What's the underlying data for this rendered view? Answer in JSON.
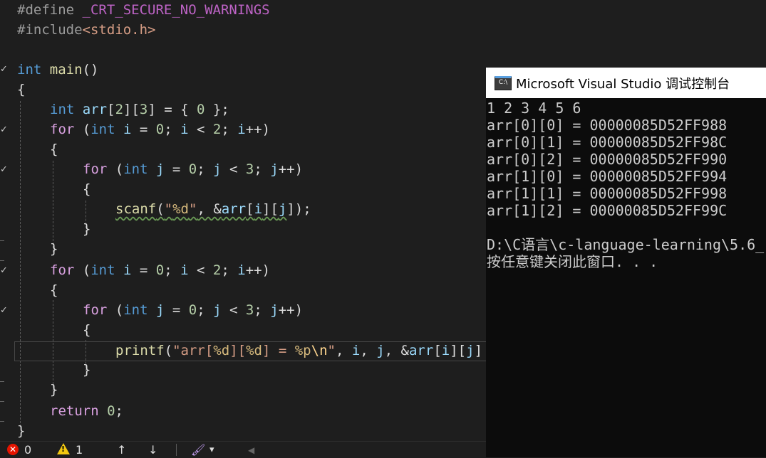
{
  "editor": {
    "lines": {
      "l1": {
        "pp": "#define",
        "macro": " _CRT_SECURE_NO_WARNINGS"
      },
      "l2": {
        "pp": "#include",
        "inc": "<stdio.h>"
      },
      "l4": {
        "kw": "int",
        "fn": "main",
        "rest": "()"
      },
      "l5": "{",
      "l6": {
        "kw": "int",
        "var": "arr",
        "b1": "[",
        "n1": "2",
        "b2": "][",
        "n2": "3",
        "b3": "] = { ",
        "n3": "0",
        "b4": " };"
      },
      "l7": {
        "ctl": "for",
        "p1": " (",
        "kw": "int",
        "v1": " i",
        "p2": " = ",
        "n1": "0",
        "p3": "; ",
        "v2": "i",
        "p4": " < ",
        "n2": "2",
        "p5": "; ",
        "v3": "i",
        "p6": "++)"
      },
      "l8": "{",
      "l9": {
        "ctl": "for",
        "p1": " (",
        "kw": "int",
        "v1": " j",
        "p2": " = ",
        "n1": "0",
        "p3": "; ",
        "v2": "j",
        "p4": " < ",
        "n2": "3",
        "p5": "; ",
        "v3": "j",
        "p6": "++)"
      },
      "l10": "{",
      "l11": {
        "fn": "scanf",
        "p1": "(",
        "s1": "\"",
        "f1": "%d",
        "s2": "\"",
        "p2": ", &",
        "v1": "arr",
        "p3": "[",
        "v2": "i",
        "p4": "][",
        "v3": "j",
        "p5": "]);"
      },
      "l12": "}",
      "l13": "}",
      "l14": {
        "ctl": "for",
        "p1": " (",
        "kw": "int",
        "v1": " i",
        "p2": " = ",
        "n1": "0",
        "p3": "; ",
        "v2": "i",
        "p4": " < ",
        "n2": "2",
        "p5": "; ",
        "v3": "i",
        "p6": "++)"
      },
      "l15": "{",
      "l16": {
        "ctl": "for",
        "p1": " (",
        "kw": "int",
        "v1": " j",
        "p2": " = ",
        "n1": "0",
        "p3": "; ",
        "v2": "j",
        "p4": " < ",
        "n2": "3",
        "p5": "; ",
        "v3": "j",
        "p6": "++)"
      },
      "l17": "{",
      "l18": {
        "fn": "printf",
        "p1": "(",
        "s1": "\"arr[",
        "f1": "%d",
        "s2": "][",
        "f2": "%d",
        "s3": "] = ",
        "f3": "%p",
        "e1": "\\n",
        "s4": "\"",
        "p2": ", ",
        "v1": "i",
        "p3": ", ",
        "v2": "j",
        "p4": ", &",
        "v3": "arr",
        "p5": "[",
        "v4": "i",
        "p6": "][",
        "v5": "j",
        "p7": "]"
      },
      "l19": "}",
      "l20": "}",
      "l21": {
        "ctl": "return",
        "p1": " ",
        "n1": "0",
        "p2": ";"
      },
      "l22": "}"
    }
  },
  "console": {
    "title": "Microsoft Visual Studio 调试控制台",
    "icon_text": "C:\\",
    "lines": [
      "1 2 3 4 5 6",
      "arr[0][0] = 00000085D52FF988",
      "arr[0][1] = 00000085D52FF98C",
      "arr[0][2] = 00000085D52FF990",
      "arr[1][0] = 00000085D52FF994",
      "arr[1][1] = 00000085D52FF998",
      "arr[1][2] = 00000085D52FF99C",
      "",
      "D:\\C语言\\c-language-learning\\5.6_",
      "按任意键关闭此窗口. . ."
    ]
  },
  "statusbar": {
    "errors": "0",
    "warnings": "1",
    "error_icon_glyph": "✕",
    "warn_icon_glyph": "!",
    "up_arrow": "↑",
    "down_arrow": "↓",
    "brush_icon": "🖌",
    "dropdown_glyph": "▾",
    "scroll_left_glyph": "◀"
  },
  "colors": {
    "editor_bg": "#1e1e1e",
    "keyword": "#569cd6",
    "control": "#d8a0df",
    "function": "#dcdcaa",
    "variable": "#9cdcfe",
    "number": "#b5cea8",
    "string": "#d69d85",
    "console_bg": "#0c0c0c"
  }
}
